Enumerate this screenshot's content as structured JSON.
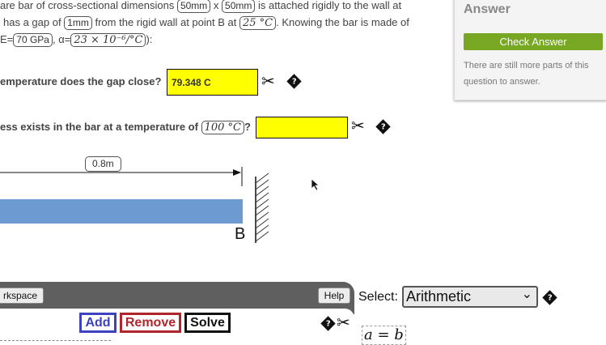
{
  "question": {
    "line1": {
      "prefix": "are bar of cross-sectional dimensions",
      "dim1": "50mm",
      "sep": "x",
      "dim2": "50mm",
      "suffix": "is attached rigidly to the wall at"
    },
    "line2": {
      "prefix": "has a gap of",
      "gap": "1mm",
      "mid": "from the rigid wall at point B at",
      "temp": "25 °C",
      "suffix": ". Knowing the bar is made of"
    },
    "line3": {
      "e_label": "E=",
      "e_value": "70 GPa",
      "alpha_label": ", α=",
      "alpha_value": "23 × 10⁻⁶/°C",
      "end": "):"
    }
  },
  "part_a": {
    "text": "emperature does the gap close?",
    "answer_value": "79.348 C"
  },
  "part_b": {
    "text": "ess exists in the bar at a temperature of",
    "temp": "100 °C",
    "question_mark": "?",
    "answer_value": ""
  },
  "diagram": {
    "length_label": "0.8m",
    "point_label": "B",
    "bar_color": "#6e9ad2"
  },
  "answer_panel": {
    "title": "Answer",
    "check_button": "Check Answer",
    "note": "There are still more parts of this question to answer.",
    "accent": "#77a723"
  },
  "workspace": {
    "tab_label": "rkspace",
    "help_label": "Help",
    "add_label": "Add",
    "remove_label": "Remove",
    "solve_label": "Solve"
  },
  "select": {
    "label": "Select:",
    "value": "Arithmetic",
    "chevron": "⌄"
  },
  "equation": {
    "text": "a = b"
  },
  "icons": {
    "scissors": "✂",
    "help_diamond": "?"
  }
}
